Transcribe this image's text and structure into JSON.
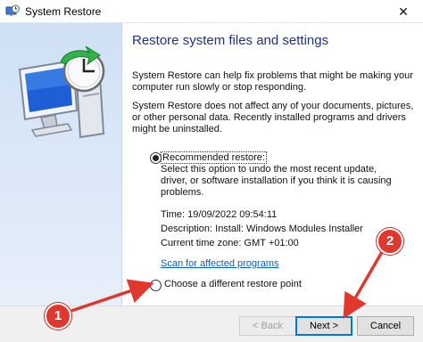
{
  "window": {
    "title": "System Restore",
    "close_glyph": "✕",
    "app_icon": "system-restore-icon"
  },
  "main": {
    "heading": "Restore system files and settings",
    "para1": "System Restore can help fix problems that might be making your computer run slowly or stop responding.",
    "para2": "System Restore does not affect any of your documents, pictures, or other personal data. Recently installed programs and drivers might be uninstalled.",
    "recommended": {
      "label": "Recommended restore:",
      "checked": true,
      "description": "Select this option to undo the most recent update, driver, or software installation if you think it is causing problems.",
      "time": "Time: 19/09/2022 09:54:11",
      "description_line": "Description: Install: Windows Modules Installer",
      "timezone": "Current time zone: GMT +01:00",
      "scan_link": "Scan for affected programs"
    },
    "different": {
      "label": "Choose a different restore point",
      "checked": false
    }
  },
  "buttons": {
    "back": "< Back",
    "next": "Next >",
    "cancel": "Cancel"
  },
  "annotations": {
    "marker1": "1",
    "marker2": "2",
    "color": "#e0382f"
  }
}
